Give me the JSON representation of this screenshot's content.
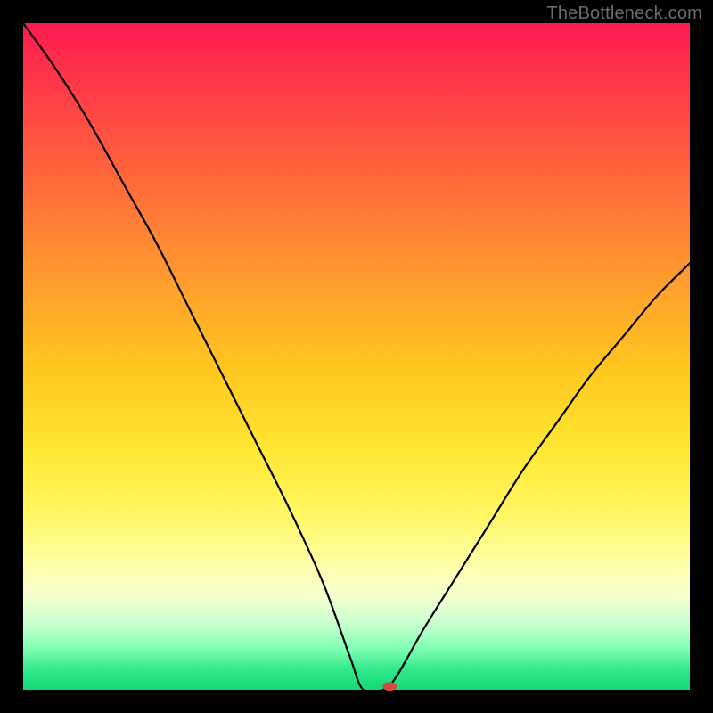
{
  "watermark": "TheBottleneck.com",
  "chart_data": {
    "type": "line",
    "title": "",
    "xlabel": "",
    "ylabel": "",
    "xlim": [
      0,
      100
    ],
    "ylim": [
      0,
      100
    ],
    "grid": false,
    "legend": false,
    "series": [
      {
        "name": "curve",
        "x": [
          0,
          5,
          10,
          15,
          20,
          25,
          30,
          35,
          40,
          45,
          49,
          51,
          54,
          56,
          60,
          65,
          70,
          75,
          80,
          85,
          90,
          95,
          100
        ],
        "y": [
          100,
          93,
          85,
          76,
          67,
          57,
          47,
          37,
          27,
          16,
          5,
          0,
          0,
          2,
          9,
          17,
          25,
          33,
          40,
          47,
          53,
          59,
          64
        ]
      }
    ],
    "marker": {
      "x": 55,
      "y": 0.5,
      "color": "#c94f45",
      "rx": 8,
      "ry": 5
    }
  }
}
